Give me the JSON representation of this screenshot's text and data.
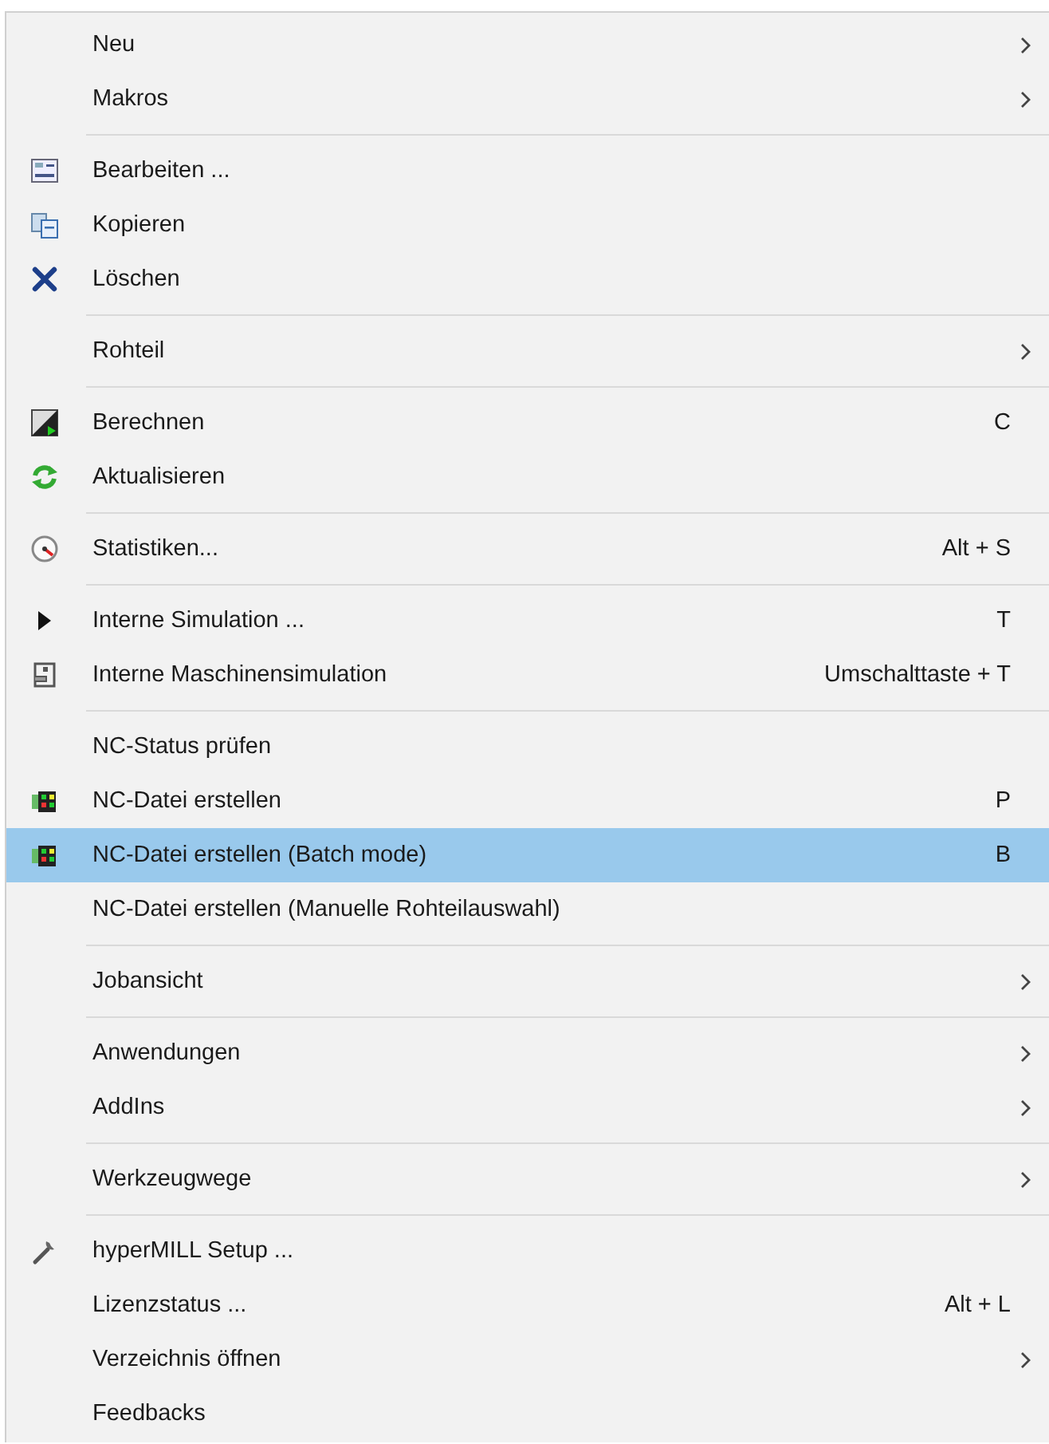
{
  "menu": {
    "sections": [
      {
        "items": [
          {
            "label": "Neu",
            "submenu": true,
            "selected": false
          },
          {
            "label": "Makros",
            "submenu": true,
            "selected": false
          }
        ]
      },
      {
        "items": [
          {
            "label": "Bearbeiten ...",
            "kind": "edit",
            "selected": false
          },
          {
            "label": "Kopieren",
            "kind": "copy",
            "selected": false
          },
          {
            "label": "Löschen",
            "kind": "delete",
            "selected": false
          }
        ]
      },
      {
        "items": [
          {
            "label": "Rohteil",
            "submenu": true,
            "selected": false
          }
        ]
      },
      {
        "items": [
          {
            "label": "Berechnen",
            "kind": "calculate",
            "shortcut": "C",
            "selected": false
          },
          {
            "label": "Aktualisieren",
            "kind": "refresh",
            "selected": false
          }
        ]
      },
      {
        "items": [
          {
            "label": "Statistiken...",
            "kind": "statistics",
            "shortcut": "Alt + S",
            "selected": false
          }
        ]
      },
      {
        "items": [
          {
            "label": "Interne Simulation ...",
            "kind": "simulate",
            "shortcut": "T",
            "selected": false
          },
          {
            "label": "Interne Maschinensimulation",
            "kind": "machine",
            "shortcut": "Umschalttaste + T",
            "selected": false
          }
        ]
      },
      {
        "items": [
          {
            "label": "NC-Status prüfen",
            "selected": false
          },
          {
            "label": "NC-Datei erstellen",
            "kind": "nc",
            "shortcut": "P",
            "selected": false
          },
          {
            "label": "NC-Datei erstellen (Batch mode)",
            "kind": "nc",
            "shortcut": "B",
            "selected": true
          },
          {
            "label": "NC-Datei erstellen (Manuelle Rohteilauswahl)",
            "selected": false
          }
        ]
      },
      {
        "items": [
          {
            "label": "Jobansicht",
            "submenu": true,
            "selected": false
          }
        ]
      },
      {
        "items": [
          {
            "label": "Anwendungen",
            "submenu": true,
            "selected": false
          },
          {
            "label": "AddIns",
            "submenu": true,
            "selected": false
          }
        ]
      },
      {
        "items": [
          {
            "label": "Werkzeugwege",
            "submenu": true,
            "selected": false
          }
        ]
      },
      {
        "items": [
          {
            "label": "hyperMILL Setup ...",
            "kind": "setup",
            "selected": false
          },
          {
            "label": "Lizenzstatus ...",
            "shortcut": "Alt + L",
            "selected": false
          },
          {
            "label": "Verzeichnis öffnen",
            "submenu": true,
            "selected": false
          },
          {
            "label": "Feedbacks",
            "selected": false
          }
        ]
      }
    ]
  }
}
